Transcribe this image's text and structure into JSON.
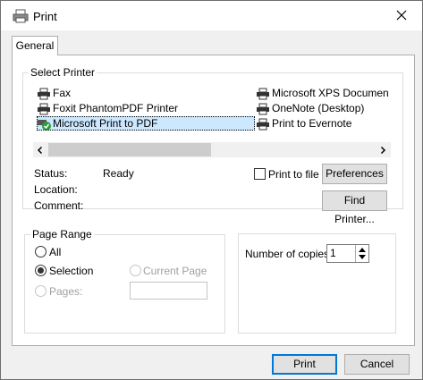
{
  "window": {
    "title": "Print"
  },
  "tabs": [
    {
      "label": "General"
    }
  ],
  "select_printer": {
    "legend": "Select Printer",
    "printers": [
      {
        "name": "Fax",
        "selected": false
      },
      {
        "name": "Foxit PhantomPDF Printer",
        "selected": false
      },
      {
        "name": "Microsoft Print to PDF",
        "selected": true,
        "default": true
      },
      {
        "name": "Microsoft XPS Document Writer",
        "selected": false
      },
      {
        "name": "OneNote (Desktop)",
        "selected": false
      },
      {
        "name": "Print to Evernote",
        "selected": false
      }
    ],
    "status_label": "Status:",
    "status_value": "Ready",
    "location_label": "Location:",
    "comment_label": "Comment:",
    "print_to_file_label": "Print to file",
    "print_to_file_checked": false,
    "preferences_label": "Preferences",
    "find_printer_label": "Find Printer..."
  },
  "page_range": {
    "legend": "Page Range",
    "all_label": "All",
    "selection_label": "Selection",
    "current_page_label": "Current Page",
    "pages_label": "Pages:",
    "selected_option": "Selection",
    "pages_value": ""
  },
  "copies": {
    "label": "Number of copies:",
    "value": "1"
  },
  "footer": {
    "print_label": "Print",
    "cancel_label": "Cancel"
  },
  "icons": {
    "window": "printer-icon",
    "close": "close-icon",
    "printer": "printer-icon",
    "default_printer": "default-check-icon",
    "scroll_left": "chevron-left-icon",
    "scroll_right": "chevron-right-icon",
    "spin_up": "caret-up-icon",
    "spin_down": "caret-down-icon"
  },
  "colors": {
    "selection": "#cce8ff",
    "default_button_border": "#0078d7",
    "window_bg": "#f0f0f0"
  }
}
